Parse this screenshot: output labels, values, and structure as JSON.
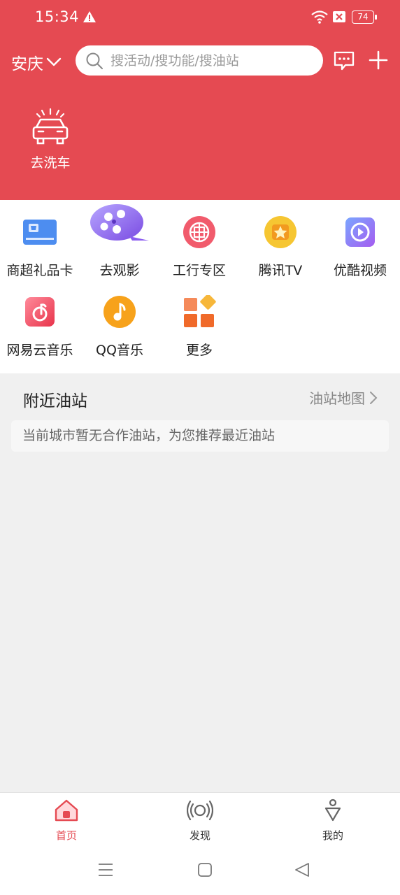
{
  "status": {
    "time": "15:34",
    "battery": "74"
  },
  "header": {
    "city": "安庆",
    "search_placeholder": "搜活动/搜功能/搜油站",
    "wash_label": "去洗车"
  },
  "grid": [
    {
      "label": "商超礼品卡",
      "icon": "gift-card-icon"
    },
    {
      "label": "去观影",
      "icon": "film-reel-icon"
    },
    {
      "label": "工行专区",
      "icon": "icbc-icon"
    },
    {
      "label": "腾讯TV",
      "icon": "tencent-tv-icon"
    },
    {
      "label": "优酷视频",
      "icon": "youku-icon"
    },
    {
      "label": "网易云音乐",
      "icon": "netease-music-icon"
    },
    {
      "label": "QQ音乐",
      "icon": "qq-music-icon"
    },
    {
      "label": "更多",
      "icon": "more-grid-icon"
    }
  ],
  "nearby": {
    "title": "附近油站",
    "map_link": "油站地图",
    "notice": "当前城市暂无合作油站，为您推荐最近油站"
  },
  "tabs": [
    {
      "label": "首页",
      "icon": "home-icon",
      "active": true
    },
    {
      "label": "发现",
      "icon": "discover-icon",
      "active": false
    },
    {
      "label": "我的",
      "icon": "profile-icon",
      "active": false
    }
  ],
  "colors": {
    "brand": "#e54a52",
    "background": "#f0f0f0"
  }
}
